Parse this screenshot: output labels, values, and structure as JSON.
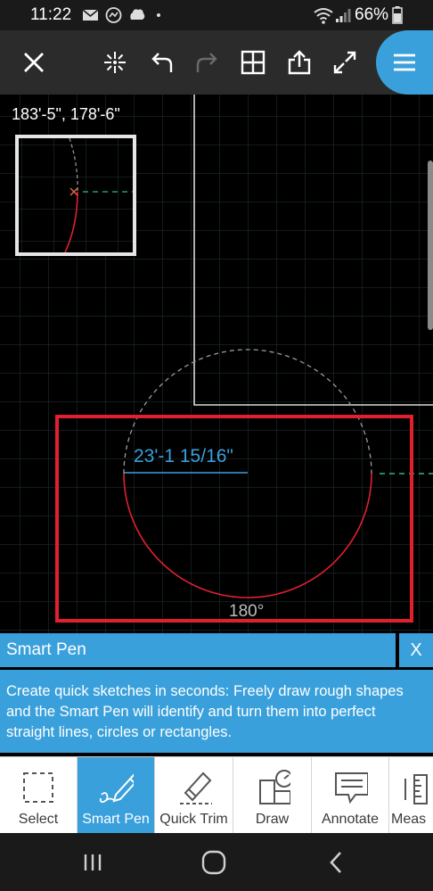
{
  "status_bar": {
    "time": "11:22",
    "battery": "66%",
    "notification_icons": [
      "mail-icon",
      "messenger-icon",
      "app-notification-icon"
    ],
    "indicator_icons": [
      "wifi-icon",
      "signal-icon",
      "battery-icon"
    ]
  },
  "toolbar": {
    "buttons": [
      "close-icon",
      "snap-icon",
      "undo-icon",
      "redo-icon",
      "grid-icon",
      "share-icon",
      "fullscreen-icon"
    ],
    "menu_icon": "menu-icon"
  },
  "canvas": {
    "coordinates": "183'-5\", 178'-6\"",
    "dimension_label": "23'-1 15/16\"",
    "angle_label": "180°",
    "colors": {
      "accent": "#3aa0db",
      "highlight": "#e0202e",
      "sketch": "#e0202e",
      "grid": "#2a3a40"
    }
  },
  "smart_pen_panel": {
    "title": "Smart Pen",
    "close_label": "X",
    "description": "Create quick sketches in seconds: Freely draw rough shapes and the Smart Pen will identify and turn them into perfect straight lines, circles or rectangles."
  },
  "bottom_tools": [
    {
      "label": "Select",
      "icon": "select-icon",
      "active": false
    },
    {
      "label": "Smart Pen",
      "icon": "smart-pen-icon",
      "active": true
    },
    {
      "label": "Quick Trim",
      "icon": "quick-trim-icon",
      "active": false
    },
    {
      "label": "Draw",
      "icon": "draw-icon",
      "active": false
    },
    {
      "label": "Annotate",
      "icon": "annotate-icon",
      "active": false
    },
    {
      "label": "Meas",
      "icon": "measure-icon",
      "active": false
    }
  ],
  "nav_bar": {
    "buttons": [
      "recent-apps-icon",
      "home-icon",
      "back-icon"
    ]
  }
}
